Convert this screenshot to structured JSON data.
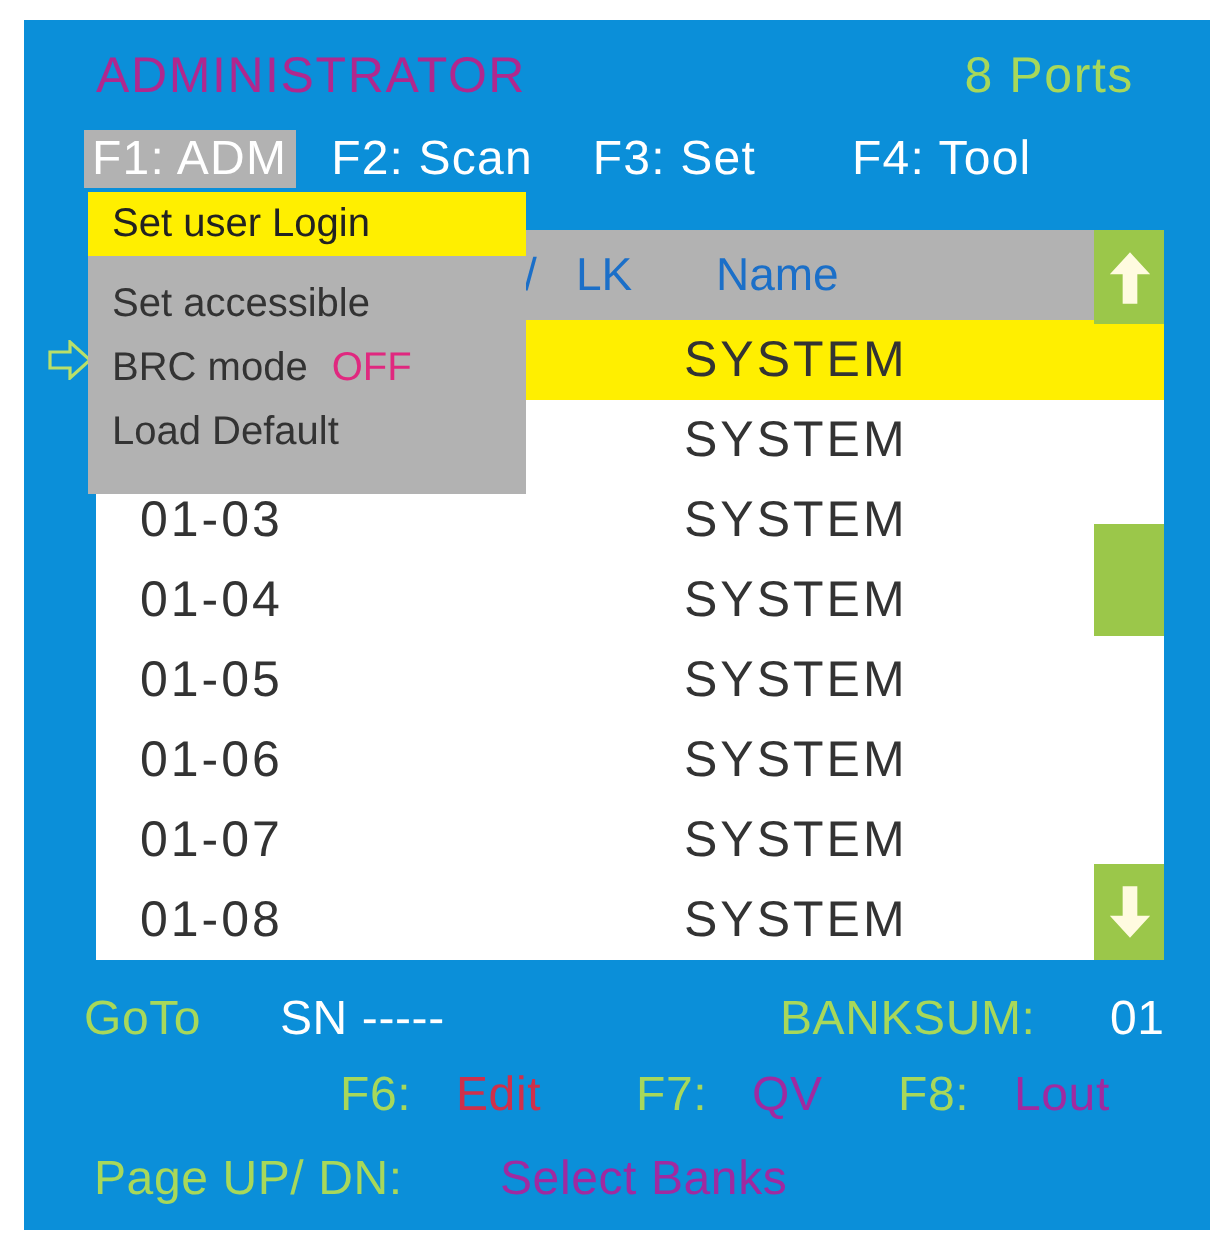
{
  "header": {
    "title": "ADMINISTRATOR",
    "ports": "8 Ports"
  },
  "menu_bar": [
    {
      "label": "F1: ADM",
      "selected": true
    },
    {
      "label": "F2: Scan",
      "selected": false
    },
    {
      "label": "F3: Set",
      "selected": false
    },
    {
      "label": "F4: Tool",
      "selected": false
    }
  ],
  "dropdown": {
    "items": [
      {
        "kind": "action",
        "label": "Set user Login",
        "selected": true
      },
      {
        "kind": "action",
        "label": "Set accessible",
        "selected": false
      },
      {
        "kind": "toggle",
        "label": "BRC mode",
        "value": "OFF",
        "selected": false
      },
      {
        "kind": "action",
        "label": "Load Default",
        "selected": false
      }
    ]
  },
  "table": {
    "columns": [
      "/",
      "LK",
      "Name"
    ],
    "rows": [
      {
        "name": "SYSTEM",
        "selected": true
      },
      {
        "name": "SYSTEM",
        "selected": false
      },
      {
        "sn": "01-03",
        "name": "SYSTEM",
        "selected": false
      },
      {
        "sn": "01-04",
        "name": "SYSTEM",
        "selected": false
      },
      {
        "sn": "01-05",
        "name": "SYSTEM",
        "selected": false
      },
      {
        "sn": "01-06",
        "name": "SYSTEM",
        "selected": false
      },
      {
        "sn": "01-07",
        "name": "SYSTEM",
        "selected": false
      },
      {
        "sn": "01-08",
        "name": "SYSTEM",
        "selected": false
      }
    ]
  },
  "footer": {
    "goto": "GoTo",
    "sn": "SN -----",
    "banksum_label": "BANKSUM:",
    "banksum": "01",
    "keys": [
      {
        "key": "F6:",
        "action": "Edit",
        "color": "#d0304a"
      },
      {
        "key": "F7:",
        "action": "QV",
        "color": "#a02aa0"
      },
      {
        "key": "F8:",
        "action": "Lout",
        "color": "#a02aa0"
      }
    ],
    "page_label": "Page UP/ DN:",
    "page_action": "Select Banks"
  }
}
